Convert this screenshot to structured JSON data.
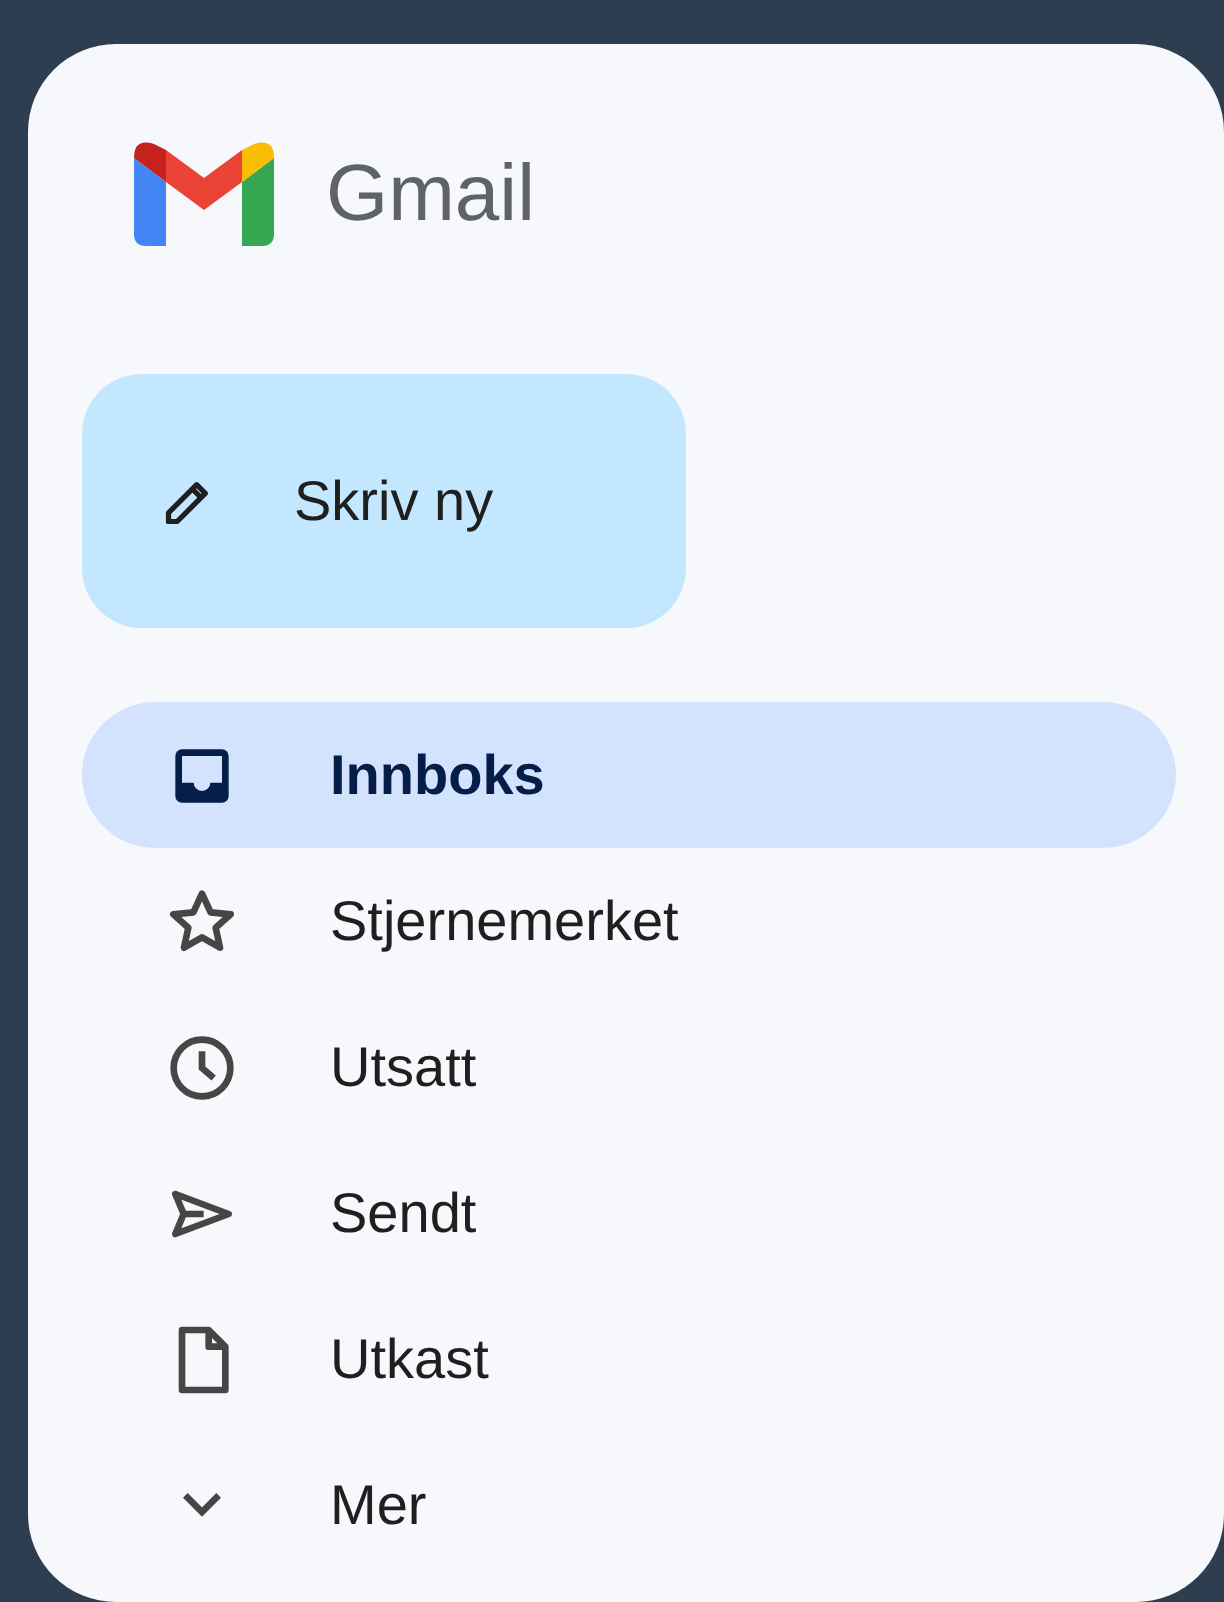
{
  "app": {
    "title": "Gmail"
  },
  "compose": {
    "label": "Skriv ny"
  },
  "nav": [
    {
      "kind": "inbox",
      "label": "Innboks",
      "selected": true
    },
    {
      "kind": "starred",
      "label": "Stjernemerket",
      "selected": false
    },
    {
      "kind": "snoozed",
      "label": "Utsatt",
      "selected": false
    },
    {
      "kind": "sent",
      "label": "Sendt",
      "selected": false
    },
    {
      "kind": "drafts",
      "label": "Utkast",
      "selected": false
    },
    {
      "kind": "more",
      "label": "Mer",
      "selected": false
    }
  ]
}
